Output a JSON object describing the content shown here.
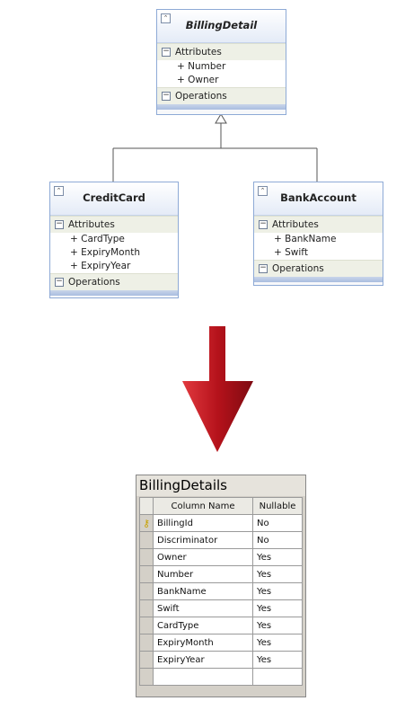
{
  "classes": {
    "billing": {
      "title": "BillingDetail",
      "attributes_label": "Attributes",
      "members": [
        "+ Number",
        "+ Owner"
      ],
      "operations_label": "Operations"
    },
    "credit": {
      "title": "CreditCard",
      "attributes_label": "Attributes",
      "members": [
        "+ CardType",
        "+ ExpiryMonth",
        "+ ExpiryYear"
      ],
      "operations_label": "Operations"
    },
    "bank": {
      "title": "BankAccount",
      "attributes_label": "Attributes",
      "members": [
        "+ BankName",
        "+ Swift"
      ],
      "operations_label": "Operations"
    }
  },
  "table": {
    "title": "BillingDetails",
    "col_name_header": "Column Name",
    "col_nullable_header": "Nullable",
    "rows": [
      {
        "name": "BillingId",
        "nullable": "No",
        "key": true
      },
      {
        "name": "Discriminator",
        "nullable": "No"
      },
      {
        "name": "Owner",
        "nullable": "Yes"
      },
      {
        "name": "Number",
        "nullable": "Yes"
      },
      {
        "name": "BankName",
        "nullable": "Yes"
      },
      {
        "name": "Swift",
        "nullable": "Yes"
      },
      {
        "name": "CardType",
        "nullable": "Yes"
      },
      {
        "name": "ExpiryMonth",
        "nullable": "Yes"
      },
      {
        "name": "ExpiryYear",
        "nullable": "Yes"
      },
      {
        "name": "",
        "nullable": ""
      }
    ]
  },
  "colors": {
    "arrow": "#b5121b",
    "class_border": "#8eaad6"
  }
}
